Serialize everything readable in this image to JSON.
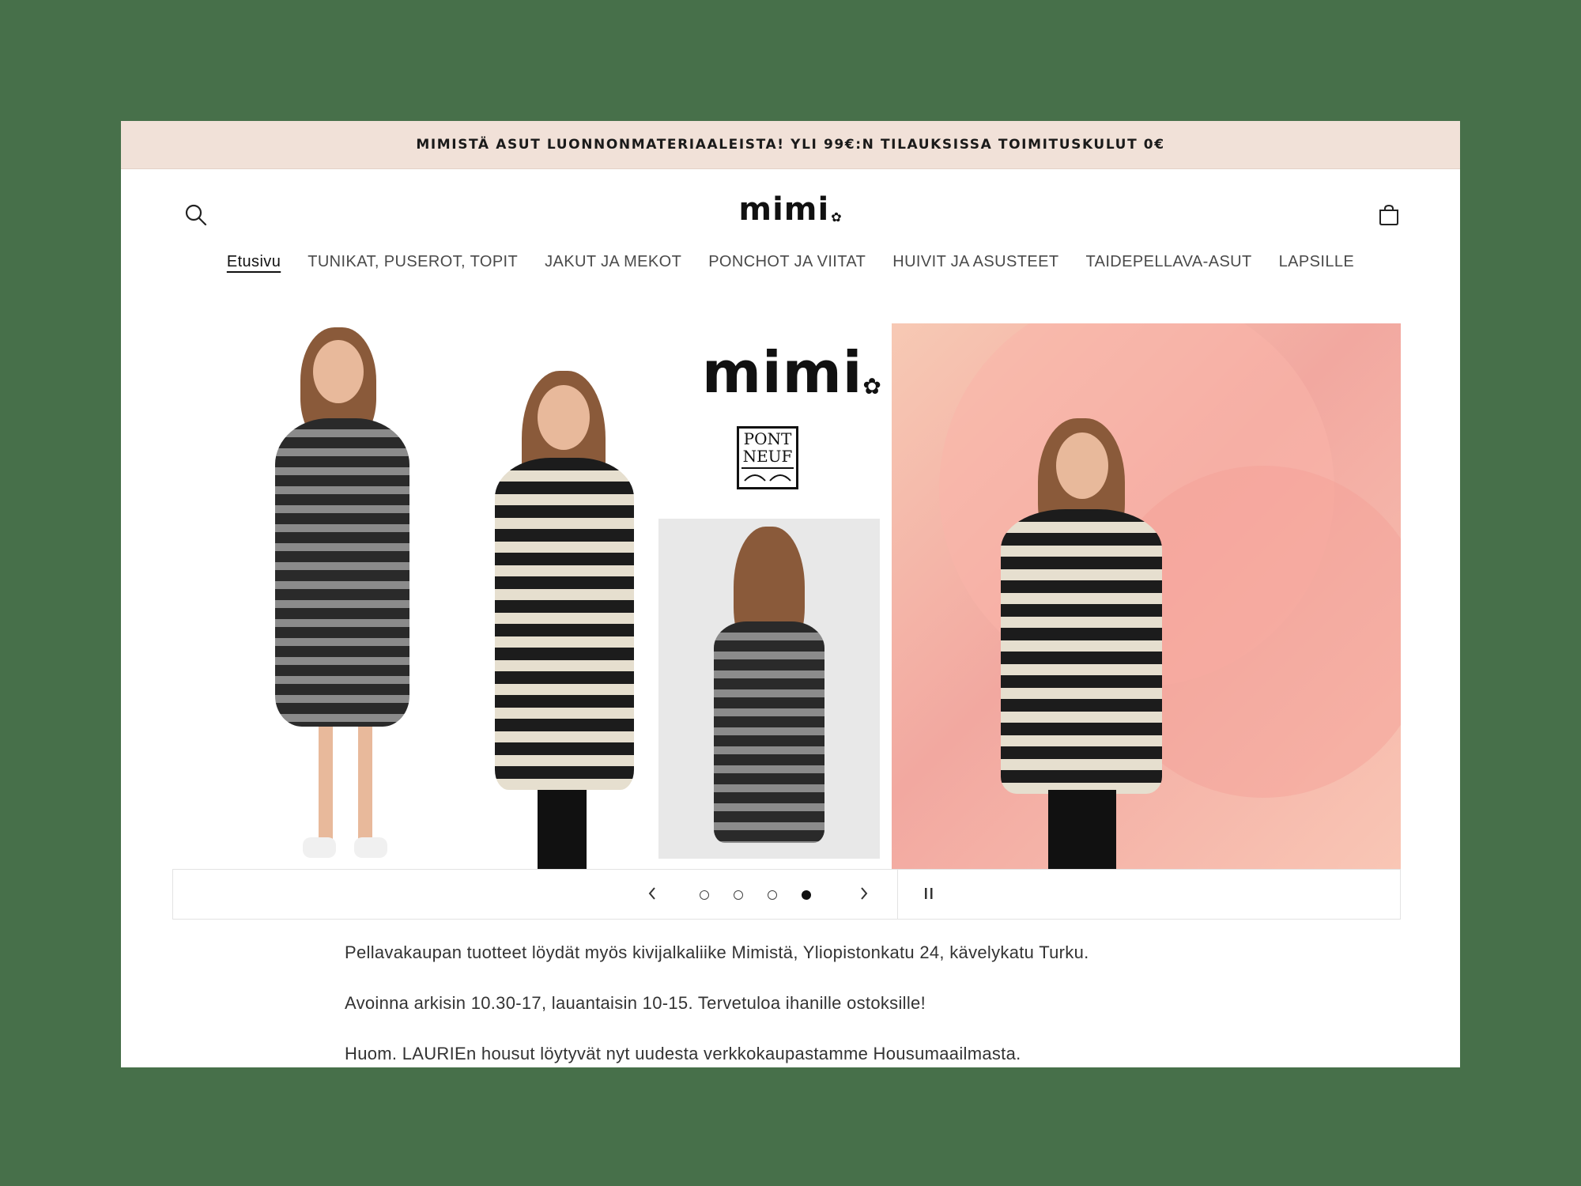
{
  "announcement": "MIMISTÄ ASUT LUONNONMATERIAALEISTA! YLI 99€:N TILAUKSISSA TOIMITUSKULUT 0€",
  "header": {
    "logo": "mimi",
    "search_icon": "search-icon",
    "cart_icon": "cart-icon"
  },
  "nav": {
    "items": [
      {
        "label": "Etusivu",
        "active": true
      },
      {
        "label": "TUNIKAT, PUSEROT, TOPIT"
      },
      {
        "label": "JAKUT JA MEKOT"
      },
      {
        "label": "PONCHOT JA VIITAT"
      },
      {
        "label": "HUIVIT JA ASUSTEET"
      },
      {
        "label": "TAIDEPELLAVA-ASUT"
      },
      {
        "label": "LAPSILLE"
      }
    ]
  },
  "slideshow": {
    "brand_logo": "mimi",
    "partner_logo_line1": "PONT",
    "partner_logo_line2": "NEUF",
    "total_slides": 4,
    "current_slide": 4,
    "prev_icon": "chevron-left-icon",
    "next_icon": "chevron-right-icon",
    "pause_icon": "pause-icon"
  },
  "content": {
    "p1": "Pellavakaupan tuotteet löydät myös kivijalkaliike Mimistä, Yliopistonkatu 24, kävelykatu Turku.",
    "p2": "Avoinna arkisin 10.30-17, lauantaisin 10-15. Tervetuloa ihanille ostoksille!",
    "p3": "Huom. LAURIEn housut löytyvät nyt uudesta verkkokaupastamme Housumaailmasta."
  },
  "colors": {
    "background": "#47704a",
    "announcement_bg": "#f1e1d8",
    "accent_dark": "#111111"
  }
}
